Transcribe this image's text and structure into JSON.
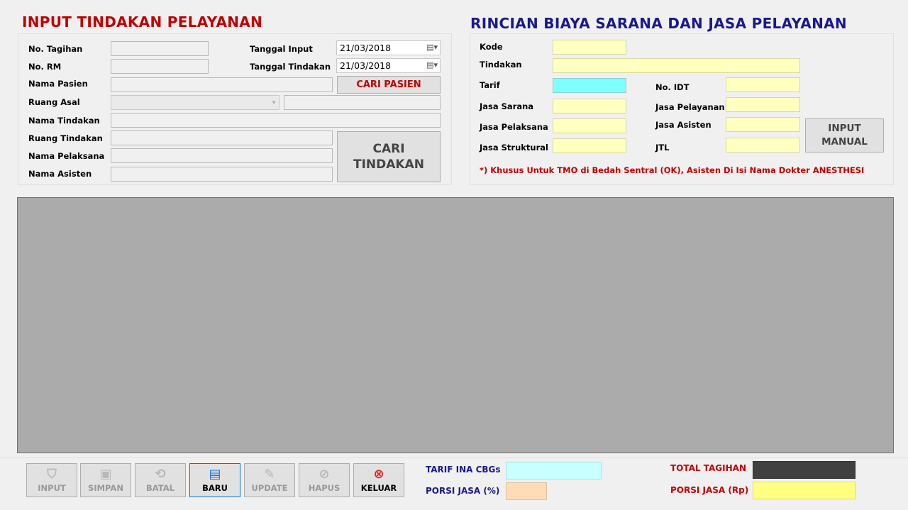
{
  "left": {
    "title": "INPUT TINDAKAN PELAYANAN",
    "labels": {
      "no_tagihan": "No. Tagihan",
      "no_rm": "No. RM",
      "nama_pasien": "Nama Pasien",
      "ruang_asal": "Ruang Asal",
      "nama_tindakan": "Nama Tindakan",
      "ruang_tindakan": "Ruang Tindakan",
      "nama_pelaksana": "Nama Pelaksana",
      "nama_asisten": "Nama Asisten",
      "tanggal_input": "Tanggal Input",
      "tanggal_tindakan": "Tanggal Tindakan"
    },
    "tanggal_input_value": "21/03/2018",
    "tanggal_tindakan_value": "21/03/2018",
    "cari_pasien": "CARI PASIEN",
    "cari_tindakan_1": "CARI",
    "cari_tindakan_2": "TINDAKAN"
  },
  "right": {
    "title": "RINCIAN BIAYA SARANA DAN JASA PELAYANAN",
    "labels": {
      "kode": "Kode",
      "tindakan": "Tindakan",
      "tarif": "Tarif",
      "jasa_sarana": "Jasa Sarana",
      "jasa_pelaksana": "Jasa Pelaksana",
      "jasa_struktural": "Jasa Struktural",
      "no_idt": "No. IDT",
      "jasa_pelayanan": "Jasa Pelayanan",
      "jasa_asisten": "Jasa Asisten",
      "jtl": "JTL"
    },
    "input_manual_1": "INPUT",
    "input_manual_2": "MANUAL",
    "note": "*) Khusus Untuk TMO di Bedah Sentral (OK), Asisten Di Isi Nama Dokter ANESTHESI"
  },
  "toolbar": {
    "input": "INPUT",
    "simpan": "SIMPAN",
    "batal": "BATAL",
    "baru": "BARU",
    "update": "UPDATE",
    "hapus": "HAPUS",
    "keluar": "KELUAR"
  },
  "footer": {
    "tarif_ina_cbgs": "TARIF INA CBGs",
    "porsi_jasa_pct": "PORSI JASA (%)",
    "total_tagihan": "TOTAL TAGIHAN",
    "porsi_jasa_rp": "PORSI JASA (Rp)"
  },
  "colors": {
    "red_title": "#c00000",
    "navy_title": "#1a1a8c",
    "yellow_field": "#ffffc0",
    "cyan_field": "#80ffff",
    "grid_bg": "#ababab"
  }
}
